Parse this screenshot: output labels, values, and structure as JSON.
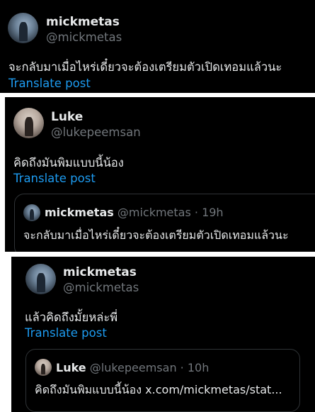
{
  "posts": [
    {
      "author_name": "mickmetas",
      "author_handle": "@mickmetas",
      "text": "จะกลับมาเมื่อไหร่เดี๋ยวจะต้องเตรียมตัวเปิดเทอมแล้วนะ",
      "translate_label": "Translate post"
    },
    {
      "author_name": "Luke",
      "author_handle": "@lukepeemsan",
      "text": "คิดถึงมันพิมแบบนี้น้อง",
      "translate_label": "Translate post",
      "quote": {
        "author_name": "mickmetas",
        "meta": "@mickmetas · 19h",
        "text": "จะกลับมาเมื่อไหร่เดี๋ยวจะต้องเตรียมตัวเปิดเทอมแล้วนะ"
      }
    },
    {
      "author_name": "mickmetas",
      "author_handle": "@mickmetas",
      "text": "แล้วคิดถึงมั้ยหล่ะพี่",
      "translate_label": "Translate post",
      "quote": {
        "author_name": "Luke",
        "meta": "@lukepeemsan · 10h",
        "text": "คิดถึงมันพิมแบบนี้น้อง x.com/mickmetas/stat..."
      }
    }
  ]
}
